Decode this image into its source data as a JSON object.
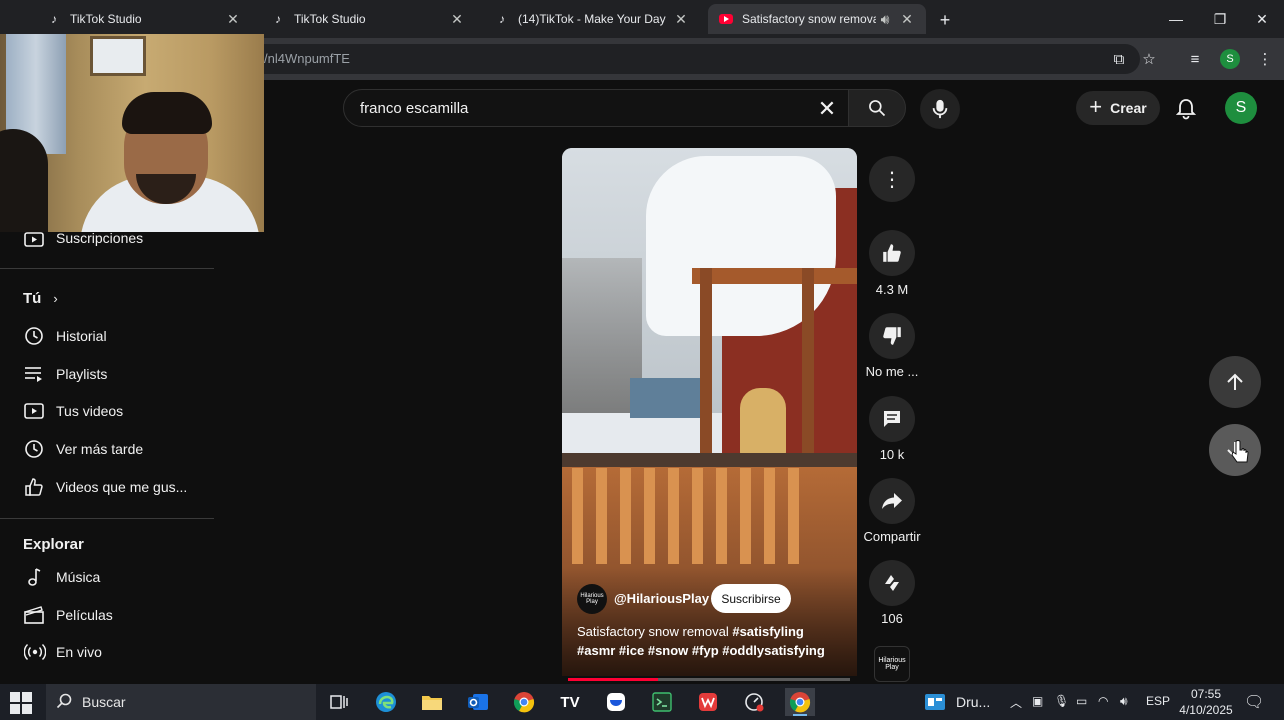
{
  "browser": {
    "tabs": [
      {
        "title": "TikTok Studio",
        "icon": "tiktok-icon"
      },
      {
        "title": "TikTok Studio",
        "icon": "tiktok-icon"
      },
      {
        "title": "(14)TikTok - Make Your Day",
        "icon": "tiktok-icon"
      },
      {
        "title": "Satisfactory snow removal #",
        "icon": "youtube-icon",
        "active": true
      }
    ],
    "url_visible": "/nl4WnpumfTE",
    "profile_initial": "S"
  },
  "header": {
    "search_value": "franco escamilla",
    "create_label": "Crear",
    "avatar_initial": "S"
  },
  "sidebar": {
    "top_items": [
      {
        "label": "Suscripciones",
        "icon": "subscriptions-icon"
      }
    ],
    "you_heading": "Tú",
    "you_items": [
      {
        "label": "Historial",
        "icon": "history-icon"
      },
      {
        "label": "Playlists",
        "icon": "playlists-icon"
      },
      {
        "label": "Tus videos",
        "icon": "your-videos-icon"
      },
      {
        "label": "Ver más tarde",
        "icon": "watch-later-icon"
      },
      {
        "label": "Videos que me gus...",
        "icon": "liked-videos-icon"
      }
    ],
    "explore_heading": "Explorar",
    "explore_items": [
      {
        "label": "Música",
        "icon": "music-icon"
      },
      {
        "label": "Películas",
        "icon": "movies-icon"
      },
      {
        "label": "En vivo",
        "icon": "live-icon"
      }
    ]
  },
  "short": {
    "channel": "@HilariousPlay",
    "channel_avatar_text": "Hilarious Play",
    "subscribe_label": "Suscribirse",
    "caption_text": "Satisfactory snow removal ",
    "caption_tags_1": "#satisfyling",
    "caption_tags_2": "#asmr #ice #snow #fyp #oddlysatisfying",
    "progress": 0.32
  },
  "actions": {
    "likes": "4.3 M",
    "dislike_label": "No me ...",
    "comments": "10 k",
    "share_label": "Compartir",
    "remix_count": "106",
    "remix_thumb_text": "Hilarious Play"
  },
  "taskbar": {
    "search_label": "Buscar",
    "pinned_app_label": "Dru...",
    "language": "ESP",
    "time": "07:55",
    "date": "4/10/2025"
  },
  "colors": {
    "youtube_red": "#ff0033",
    "avatar_green": "#1e8e3e",
    "background": "#0f0f0f"
  }
}
